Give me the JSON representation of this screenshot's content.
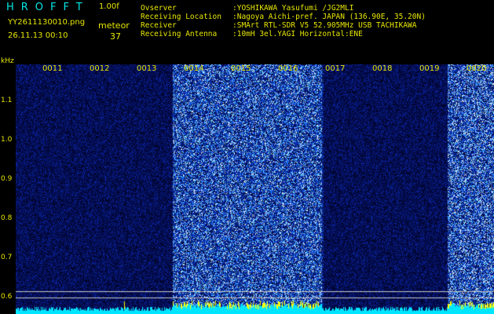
{
  "header": {
    "app_title": "HROFFT",
    "version": "1.00f",
    "filename": "YY2611130010.png",
    "timestamp": "26.11.13 00:10",
    "meteor_label": "meteor",
    "meteor_count": "37"
  },
  "info": [
    {
      "key": "Ovserver",
      "value": ":YOSHIKAWA Yasufumi /JG2MLI"
    },
    {
      "key": "Receiving Location",
      "value": ":Nagoya Aichi-pref. JAPAN (136.90E, 35.20N)"
    },
    {
      "key": "Receiver",
      "value": ":SMArt RTL-SDR V5 52.905MHz USB TACHIKAWA"
    },
    {
      "key": "Receiving Antenna",
      "value": ":10mH 3el.YAGI Horizontal:ENE"
    }
  ],
  "spectrogram": {
    "y_unit": "kHz",
    "y_ticks": [
      "1.1",
      "1.0",
      "0.9",
      "0.8",
      "0.7",
      "0.6"
    ],
    "x_ticks": [
      "0011",
      "0012",
      "0013",
      "0014",
      "0015",
      "0016",
      "0017",
      "0018",
      "0019",
      "0020"
    ],
    "colors": {
      "background": "#000000",
      "noise": "#1a3cff",
      "text": "#e6e600",
      "accent": "#00e5e5"
    }
  }
}
